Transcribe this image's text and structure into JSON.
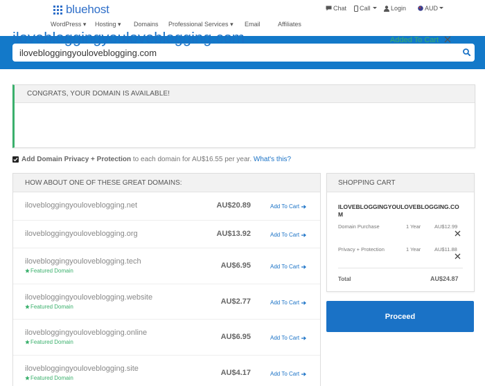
{
  "header": {
    "logo_text": "bluehost",
    "brand_color": "#2f6fc9",
    "utility": {
      "chat": "Chat",
      "call": "Call",
      "login": "Login",
      "currency": "AUD"
    },
    "nav": [
      {
        "label": "WordPress",
        "has_dropdown": true
      },
      {
        "label": "Hosting",
        "has_dropdown": true
      },
      {
        "label": "Domains",
        "has_dropdown": false
      },
      {
        "label": "Professional Services",
        "has_dropdown": true
      },
      {
        "label": "Email",
        "has_dropdown": false
      },
      {
        "label": "Affiliates",
        "has_dropdown": false
      }
    ]
  },
  "search": {
    "value": "ilovebloggingyouloveblogging.com",
    "band_color": "#1379c9"
  },
  "result": {
    "title": "CONGRATS, YOUR DOMAIN IS AVAILABLE!",
    "domain": "ilovebloggingyouloveblogging.com",
    "status": "Added To Cart",
    "accent_color": "#3ab06c"
  },
  "privacy": {
    "checked": true,
    "label_bold": "Add Domain Privacy + Protection",
    "label_rest": " to each domain for AU$16.55 per year.",
    "link": "What's this?"
  },
  "suggestions": {
    "title": "HOW ABOUT ONE OF THESE GREAT DOMAINS:",
    "add_label": "Add To Cart",
    "featured_label": "Featured Domain",
    "items": [
      {
        "domain": "ilovebloggingyouloveblogging.net",
        "price": "AU$20.89",
        "featured": false
      },
      {
        "domain": "ilovebloggingyouloveblogging.org",
        "price": "AU$13.92",
        "featured": false
      },
      {
        "domain": "ilovebloggingyouloveblogging.tech",
        "price": "AU$6.95",
        "featured": true
      },
      {
        "domain": "ilovebloggingyouloveblogging.website",
        "price": "AU$2.77",
        "featured": true
      },
      {
        "domain": "ilovebloggingyouloveblogging.online",
        "price": "AU$6.95",
        "featured": true
      },
      {
        "domain": "ilovebloggingyouloveblogging.site",
        "price": "AU$4.17",
        "featured": true
      }
    ]
  },
  "cart": {
    "title": "SHOPPING CART",
    "domain": "ILOVEBLOGGINGYOULOVEBLOGGING.COM",
    "lines": [
      {
        "label": "Domain Purchase",
        "term": "1 Year",
        "price": "AU$12.99"
      },
      {
        "label": "Privacy + Protection",
        "term": "1 Year",
        "price": "AU$11.88"
      }
    ],
    "total_label": "Total",
    "total_value": "AU$24.87",
    "proceed": "Proceed"
  }
}
